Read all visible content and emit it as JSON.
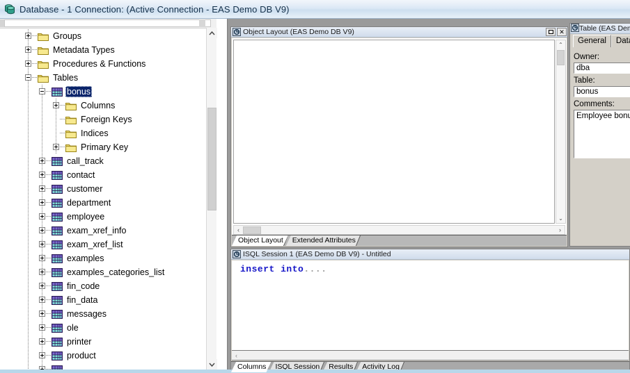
{
  "window": {
    "title": "Database - 1 Connection: (Active Connection - EAS Demo DB V9)",
    "icon": "database-icon"
  },
  "tree": {
    "nodes": [
      {
        "label": "Groups",
        "depth": 1,
        "icon": "folder-icon",
        "expander": "plus",
        "selected": false
      },
      {
        "label": "Metadata Types",
        "depth": 1,
        "icon": "folder-icon",
        "expander": "plus",
        "selected": false
      },
      {
        "label": "Procedures & Functions",
        "depth": 1,
        "icon": "folder-icon",
        "expander": "plus",
        "selected": false
      },
      {
        "label": "Tables",
        "depth": 1,
        "icon": "folder-icon",
        "expander": "minus",
        "selected": false
      },
      {
        "label": "bonus",
        "depth": 2,
        "icon": "table-icon",
        "expander": "minus",
        "selected": true
      },
      {
        "label": "Columns",
        "depth": 3,
        "icon": "folder-icon",
        "expander": "plus",
        "selected": false
      },
      {
        "label": "Foreign Keys",
        "depth": 3,
        "icon": "folder-icon",
        "expander": "none",
        "selected": false
      },
      {
        "label": "Indices",
        "depth": 3,
        "icon": "folder-icon",
        "expander": "none",
        "selected": false
      },
      {
        "label": "Primary Key",
        "depth": 3,
        "icon": "folder-icon",
        "expander": "plus",
        "selected": false
      },
      {
        "label": "call_track",
        "depth": 2,
        "icon": "table-icon",
        "expander": "plus",
        "selected": false
      },
      {
        "label": "contact",
        "depth": 2,
        "icon": "table-icon",
        "expander": "plus",
        "selected": false
      },
      {
        "label": "customer",
        "depth": 2,
        "icon": "table-icon",
        "expander": "plus",
        "selected": false
      },
      {
        "label": "department",
        "depth": 2,
        "icon": "table-icon",
        "expander": "plus",
        "selected": false
      },
      {
        "label": "employee",
        "depth": 2,
        "icon": "table-icon",
        "expander": "plus",
        "selected": false
      },
      {
        "label": "exam_xref_info",
        "depth": 2,
        "icon": "table-icon",
        "expander": "plus",
        "selected": false
      },
      {
        "label": "exam_xref_list",
        "depth": 2,
        "icon": "table-icon",
        "expander": "plus",
        "selected": false
      },
      {
        "label": "examples",
        "depth": 2,
        "icon": "table-icon",
        "expander": "plus",
        "selected": false
      },
      {
        "label": "examples_categories_list",
        "depth": 2,
        "icon": "table-icon",
        "expander": "plus",
        "selected": false
      },
      {
        "label": "fin_code",
        "depth": 2,
        "icon": "table-icon",
        "expander": "plus",
        "selected": false
      },
      {
        "label": "fin_data",
        "depth": 2,
        "icon": "table-icon",
        "expander": "plus",
        "selected": false
      },
      {
        "label": "messages",
        "depth": 2,
        "icon": "table-icon",
        "expander": "plus",
        "selected": false
      },
      {
        "label": "ole",
        "depth": 2,
        "icon": "table-icon",
        "expander": "plus",
        "selected": false
      },
      {
        "label": "printer",
        "depth": 2,
        "icon": "table-icon",
        "expander": "plus",
        "selected": false
      },
      {
        "label": "product",
        "depth": 2,
        "icon": "table-icon",
        "expander": "plus",
        "selected": false
      },
      {
        "label": "",
        "depth": 2,
        "icon": "table-icon",
        "expander": "plus",
        "selected": false
      }
    ],
    "scroll_up_icon": "chevron-up-icon",
    "scroll_down_icon": "chevron-down-icon"
  },
  "object_layout": {
    "title": "Object Layout (EAS Demo DB V9)",
    "icon": "object-layout-icon",
    "maximize_label": "maximize-icon",
    "close_label": "✕",
    "tabs": [
      {
        "label": "Object Layout",
        "active": true
      },
      {
        "label": "Extended Attributes",
        "active": false
      }
    ],
    "scroll_left_icon": "‹",
    "scroll_right_icon": "›",
    "scroll_up_icon": "⌃",
    "scroll_down_icon": "⌄"
  },
  "isql": {
    "title": "ISQL Session 1 (EAS Demo DB V9) - Untitled",
    "icon": "isql-icon",
    "sql_keyword": "insert into",
    "sql_rest": "....",
    "scroll_left_icon": "‹"
  },
  "bottom_tabs": [
    {
      "label": "Columns",
      "active": true
    },
    {
      "label": "ISQL Session",
      "active": false
    },
    {
      "label": "Results",
      "active": false
    },
    {
      "label": "Activity Log",
      "active": false
    }
  ],
  "properties": {
    "title": "Table (EAS Dem",
    "icon": "table-props-icon",
    "tabs": [
      {
        "label": "General",
        "active": true
      },
      {
        "label": "Data P",
        "active": false
      }
    ],
    "fields": [
      {
        "label": "Owner:",
        "value": "dba",
        "type": "input"
      },
      {
        "label": "Table:",
        "value": "bonus",
        "type": "input"
      },
      {
        "label": "Comments:",
        "value": "Employee bonus",
        "type": "textarea"
      }
    ]
  },
  "colors": {
    "selection": "#0a246a",
    "title_text": "#14304a",
    "sql_keyword": "#1616c8",
    "folder": "#f5e07a",
    "mdi_backdrop": "#9a9a9a"
  }
}
